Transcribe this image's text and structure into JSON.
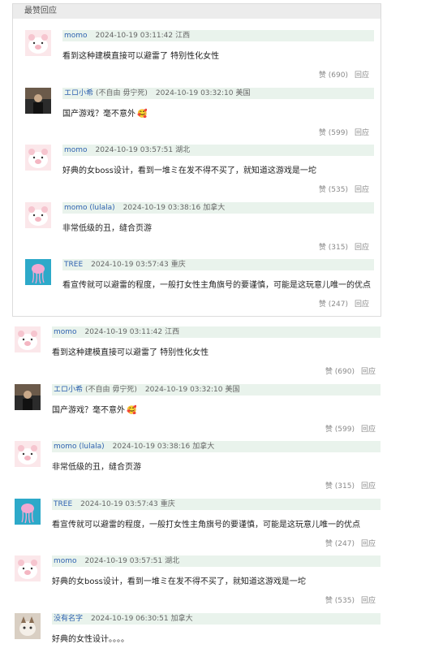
{
  "hot_section": {
    "title": "最赞回应"
  },
  "hot_comments": [
    {
      "user": "momo",
      "tag": "",
      "time": "2024-10-19 03:11:42",
      "location": "江西",
      "text": "看到这种建模直接可以避雷了 特别性化女性",
      "emoji": "",
      "likes": "赞 (690)",
      "reply": "回应",
      "avatar": "pig"
    },
    {
      "user": "エロ小希",
      "tag": "(不自由 毋宁死)",
      "time": "2024-10-19 03:32:10",
      "location": "美国",
      "text": "国产游戏？毫不意外",
      "emoji": "🥰",
      "likes": "赞 (599)",
      "reply": "回应",
      "avatar": "photo"
    },
    {
      "user": "momo",
      "tag": "",
      "time": "2024-10-19 03:57:51",
      "location": "湖北",
      "text": "好典的女boss设计，看到一堆ミ在发不得不买了，就知道这游戏是一坨",
      "emoji": "",
      "likes": "赞 (535)",
      "reply": "回应",
      "avatar": "pig"
    },
    {
      "user": "momo (lulala)",
      "tag": "",
      "time": "2024-10-19 03:38:16",
      "location": "加拿大",
      "text": "非常低级的丑，缝合页游",
      "emoji": "",
      "likes": "赞 (315)",
      "reply": "回应",
      "avatar": "pig"
    },
    {
      "user": "TREE",
      "tag": "",
      "time": "2024-10-19 03:57:43",
      "location": "重庆",
      "text": "看宣传就可以避雷的程度，一般打女性主角旗号的要谨慎，可能是这玩意儿唯一的优点",
      "emoji": "",
      "likes": "赞 (247)",
      "reply": "回应",
      "avatar": "jelly"
    }
  ],
  "all_comments": [
    {
      "user": "momo",
      "tag": "",
      "time": "2024-10-19 03:11:42",
      "location": "江西",
      "text": "看到这种建模直接可以避雷了 特别性化女性",
      "emoji": "",
      "likes": "赞 (690)",
      "reply": "回应",
      "avatar": "pig"
    },
    {
      "user": "エロ小希",
      "tag": "(不自由 毋宁死)",
      "time": "2024-10-19 03:32:10",
      "location": "美国",
      "text": "国产游戏？毫不意外",
      "emoji": "🥰",
      "likes": "赞 (599)",
      "reply": "回应",
      "avatar": "photo"
    },
    {
      "user": "momo (lulala)",
      "tag": "",
      "time": "2024-10-19 03:38:16",
      "location": "加拿大",
      "text": "非常低级的丑，缝合页游",
      "emoji": "",
      "likes": "赞 (315)",
      "reply": "回应",
      "avatar": "pig"
    },
    {
      "user": "TREE",
      "tag": "",
      "time": "2024-10-19 03:57:43",
      "location": "重庆",
      "text": "看宣传就可以避雷的程度，一般打女性主角旗号的要谨慎，可能是这玩意儿唯一的优点",
      "emoji": "",
      "likes": "赞 (247)",
      "reply": "回应",
      "avatar": "jelly"
    },
    {
      "user": "momo",
      "tag": "",
      "time": "2024-10-19 03:57:51",
      "location": "湖北",
      "text": "好典的女boss设计，看到一堆ミ在发不得不买了，就知道这游戏是一坨",
      "emoji": "",
      "likes": "赞 (535)",
      "reply": "回应",
      "avatar": "pig"
    },
    {
      "user": "没有名字",
      "tag": "",
      "time": "2024-10-19 06:30:51",
      "location": "加拿大",
      "text": "好典的女性设计。。。。",
      "emoji": "",
      "likes": "",
      "reply": "",
      "avatar": "cat"
    }
  ],
  "colors": {
    "username": "#2f62b0",
    "meta_bg": "#e9f3ec",
    "action_text": "#8a8a8a",
    "section_header_bg": "#ececec"
  }
}
